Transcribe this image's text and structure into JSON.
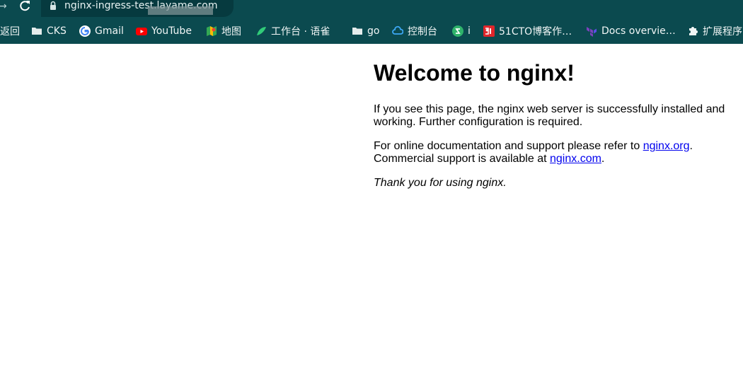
{
  "browser": {
    "url": "nginx-ingress-test.layame.com",
    "bookmarks": [
      {
        "label": "返回",
        "icon": "back-icon"
      },
      {
        "label": "CKS",
        "icon": "folder-icon"
      },
      {
        "label": "Gmail",
        "icon": "google-icon"
      },
      {
        "label": "YouTube",
        "icon": "youtube-icon"
      },
      {
        "label": "地图",
        "icon": "maps-icon"
      },
      {
        "label": "工作台 · 语雀",
        "icon": "yuque-icon"
      },
      {
        "label": "go",
        "icon": "folder-icon"
      },
      {
        "label": "控制台",
        "icon": "cloud-icon"
      },
      {
        "label": "i",
        "icon": "s-logo-icon"
      },
      {
        "label": "51CTO博客作…",
        "icon": "51cto-icon"
      },
      {
        "label": "Docs overvie…",
        "icon": "terraform-icon"
      },
      {
        "label": "扩展程序",
        "icon": "puzzle-icon"
      }
    ]
  },
  "page": {
    "heading": "Welcome to nginx!",
    "para1": "If you see this page, the nginx web server is successfully installed and working. Further configuration is required.",
    "para2_before_link1": "For online documentation and support please refer to ",
    "link1": "nginx.org",
    "para2_between": ".",
    "para2_before_link2": "Commercial support is available at ",
    "link2": "nginx.com",
    "para2_end": ".",
    "para3": "Thank you for using nginx."
  }
}
